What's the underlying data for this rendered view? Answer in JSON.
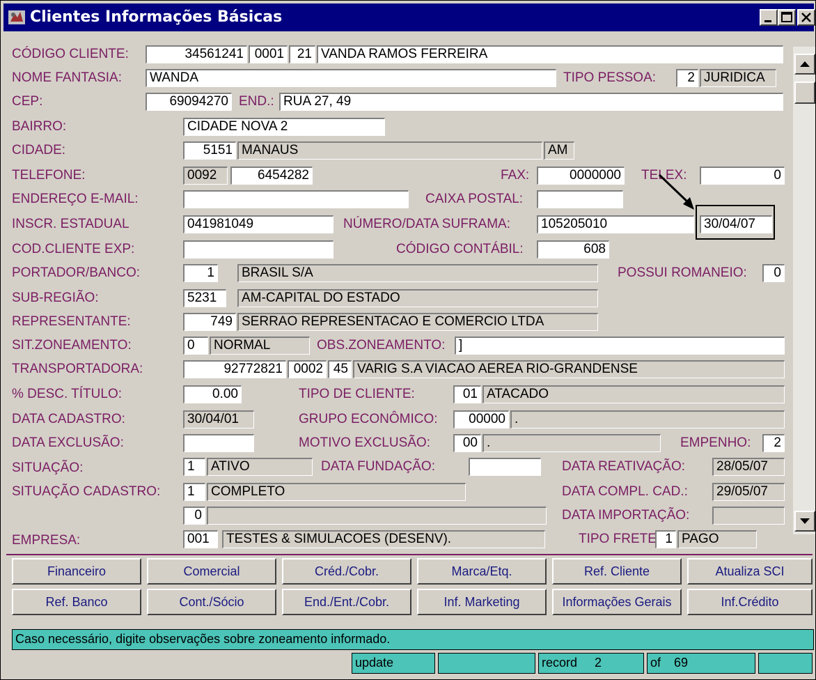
{
  "window": {
    "title": "Clientes Informações Básicas"
  },
  "icons": [
    "app-icon",
    "minimize-icon",
    "maximize-icon",
    "close-icon",
    "scroll-up-icon",
    "scroll-down-icon",
    "arrow-annotation-icon"
  ],
  "form": {
    "codigo_cliente": {
      "label": "CÓDIGO CLIENTE:",
      "cnpj": "34561241",
      "filial": "0001",
      "digito": "21",
      "nome": "VANDA RAMOS FERREIRA"
    },
    "nome_fantasia": {
      "label": "NOME FANTASIA:",
      "value": "WANDA"
    },
    "tipo_pessoa": {
      "label": "TIPO PESSOA:",
      "code": "2",
      "desc": "JURIDICA"
    },
    "cep": {
      "label": "CEP:",
      "value": "69094270"
    },
    "endereco": {
      "label": "END.:",
      "value": "RUA 27, 49"
    },
    "bairro": {
      "label": "BAIRRO:",
      "value": "CIDADE NOVA 2"
    },
    "cidade": {
      "label": "CIDADE:",
      "code": "5151",
      "name": "MANAUS",
      "uf": "AM"
    },
    "telefone": {
      "label": "TELEFONE:",
      "ddd": "0092",
      "number": "6454282"
    },
    "fax": {
      "label": "FAX:",
      "value": "0000000"
    },
    "telex": {
      "label": "TELEX:",
      "value": "0"
    },
    "email": {
      "label": "ENDEREÇO E-MAIL:",
      "value": ""
    },
    "caixa_postal": {
      "label": "CAIXA POSTAL:",
      "value": ""
    },
    "inscr_estadual": {
      "label": "INSCR. ESTADUAL",
      "value": "041981049"
    },
    "suframa": {
      "label": "NÚMERO/DATA SUFRAMA:",
      "numero": "105205010",
      "data": "30/04/07"
    },
    "cod_cliente_exp": {
      "label": "COD.CLIENTE EXP:",
      "value": ""
    },
    "codigo_contabil": {
      "label": "CÓDIGO CONTÁBIL:",
      "value": "608"
    },
    "portador": {
      "label": "PORTADOR/BANCO:",
      "code": "1",
      "name": "BRASIL S/A"
    },
    "possui_romaneio": {
      "label": "POSSUI ROMANEIO:",
      "value": "0"
    },
    "sub_regiao": {
      "label": "SUB-REGIÃO:",
      "code": "5231",
      "name": "AM-CAPITAL DO ESTADO"
    },
    "representante": {
      "label": "REPRESENTANTE:",
      "code": "749",
      "name": "SERRAO REPRESENTACAO E COMERCIO LTDA"
    },
    "sit_zoneamento": {
      "label": "SIT.ZONEAMENTO:",
      "code": "0",
      "desc": "NORMAL"
    },
    "obs_zoneamento": {
      "label": "OBS.ZONEAMENTO:",
      "value": "]"
    },
    "transportadora": {
      "label": "TRANSPORTADORA:",
      "cnpj": "92772821",
      "filial": "0002",
      "digito": "45",
      "name": "VARIG S.A VIACAO AEREA RIO-GRANDENSE"
    },
    "desc_titulo": {
      "label": "% DESC. TÍTULO:",
      "value": "0.00"
    },
    "tipo_cliente": {
      "label": "TIPO DE CLIENTE:",
      "code": "01",
      "desc": "ATACADO"
    },
    "data_cadastro": {
      "label": "DATA CADASTRO:",
      "value": "30/04/01"
    },
    "grupo_economico": {
      "label": "GRUPO ECONÔMICO:",
      "code": "00000",
      "desc": "."
    },
    "data_exclusao": {
      "label": "DATA EXCLUSÃO:",
      "value": ""
    },
    "motivo_exclusao": {
      "label": "MOTIVO EXCLUSÃO:",
      "code": "00",
      "desc": "."
    },
    "empenho": {
      "label": "EMPENHO:",
      "value": "2"
    },
    "situacao": {
      "label": "SITUAÇÃO:",
      "code": "1",
      "desc": "ATIVO"
    },
    "data_fundacao": {
      "label": "DATA FUNDAÇÃO:",
      "value": ""
    },
    "data_reativacao": {
      "label": "DATA REATIVAÇÃO:",
      "value": "28/05/07"
    },
    "situacao_cadastro": {
      "label": "SITUAÇÃO CADASTRO:",
      "code": "1",
      "desc": "COMPLETO"
    },
    "data_compl_cad": {
      "label": "DATA COMPL. CAD.:",
      "value": "29/05/07"
    },
    "extra": {
      "code": "0",
      "desc": ""
    },
    "data_importacao": {
      "label": "DATA IMPORTAÇÃO:",
      "value": ""
    },
    "empresa": {
      "label": "EMPRESA:",
      "code": "001",
      "name": "TESTES & SIMULACOES (DESENV)."
    },
    "tipo_frete": {
      "label": "TIPO FRETE:",
      "code": "1",
      "desc": "PAGO"
    }
  },
  "buttons": {
    "row1": [
      "Financeiro",
      "Comercial",
      "Créd./Cobr.",
      "Marca/Etq.",
      "Ref. Cliente",
      "Atualiza SCI"
    ],
    "row2": [
      "Ref. Banco",
      "Cont./Sócio",
      "End./Ent./Cobr.",
      "Inf. Marketing",
      "Informações Gerais",
      "Inf.Crédito"
    ]
  },
  "status": {
    "message": "Caso necessário, digite observações sobre zoneamento informado.",
    "mode": "update",
    "record_label": "record",
    "record_number": "2",
    "of_label": "of",
    "total": "69"
  }
}
